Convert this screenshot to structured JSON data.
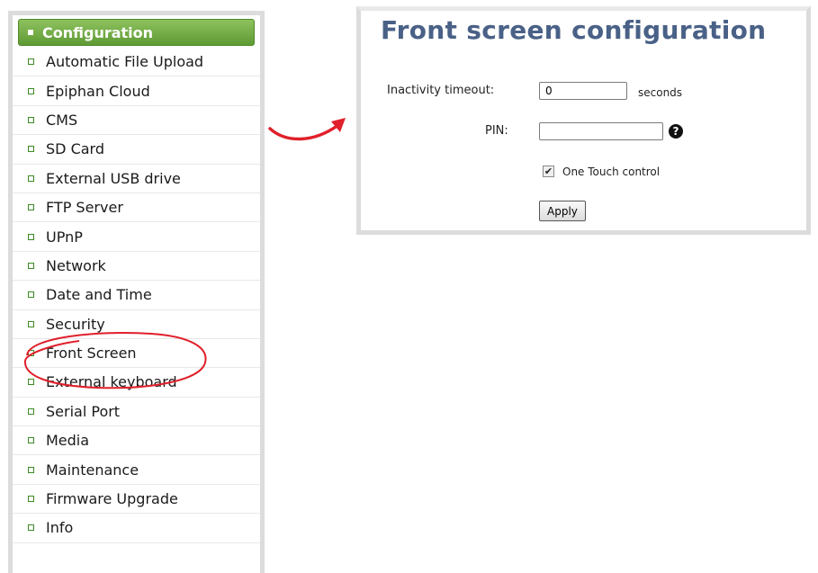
{
  "sidebar": {
    "header": "Configuration",
    "items": [
      {
        "label": "Automatic File Upload"
      },
      {
        "label": "Epiphan Cloud"
      },
      {
        "label": "CMS"
      },
      {
        "label": "SD Card"
      },
      {
        "label": "External USB drive"
      },
      {
        "label": "FTP Server"
      },
      {
        "label": "UPnP"
      },
      {
        "label": "Network"
      },
      {
        "label": "Date and Time"
      },
      {
        "label": "Security"
      },
      {
        "label": "Front Screen"
      },
      {
        "label": "External keyboard"
      },
      {
        "label": "Serial Port"
      },
      {
        "label": "Media"
      },
      {
        "label": "Maintenance"
      },
      {
        "label": "Firmware Upgrade"
      },
      {
        "label": "Info"
      }
    ]
  },
  "panel": {
    "title": "Front screen configuration",
    "inactivity_label": "Inactivity timeout:",
    "inactivity_value": "0",
    "inactivity_unit": "seconds",
    "pin_label": "PIN:",
    "pin_value": "",
    "help_glyph": "?",
    "one_touch_label": "One Touch control",
    "one_touch_checked": true,
    "apply_label": "Apply"
  },
  "annotations": {
    "arrow_color": "#e0202a",
    "highlight_color": "#e0202a",
    "highlighted_item": "Front Screen"
  },
  "colors": {
    "header_green": "#6aa63d",
    "title_blue": "#4a6187",
    "bullet_green": "#3a8a22"
  }
}
